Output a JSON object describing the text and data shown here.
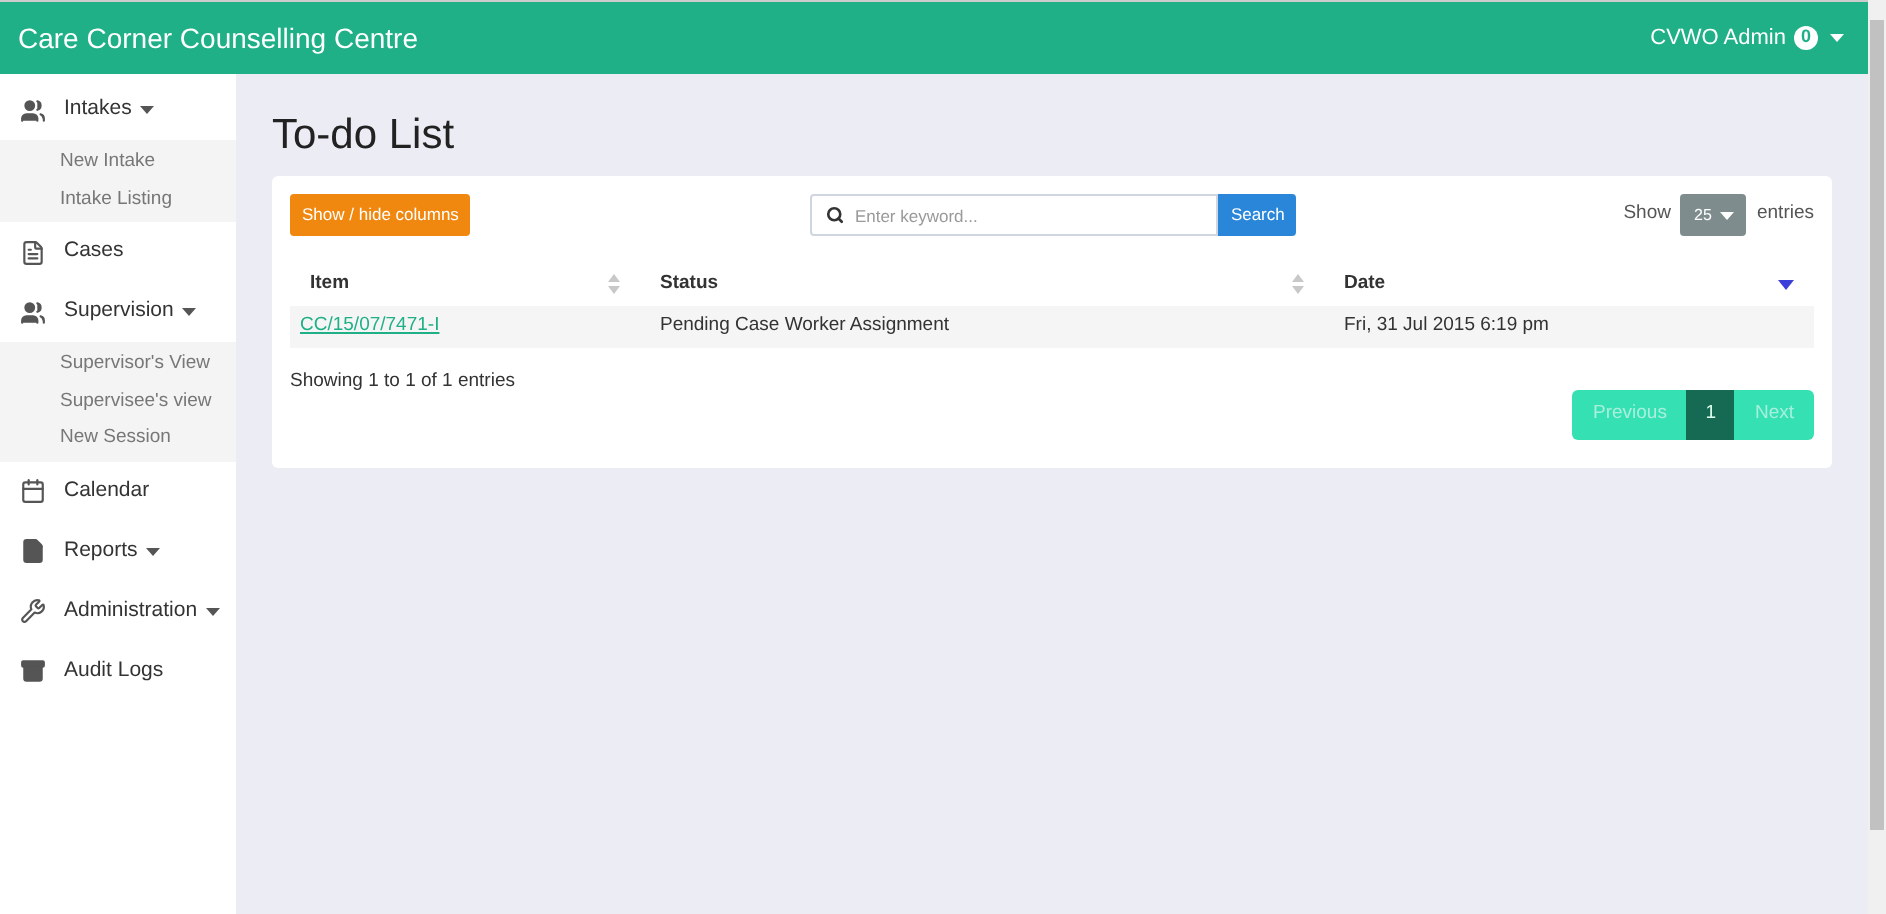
{
  "header": {
    "title": "Care Corner Counselling Centre",
    "user": "CVWO Admin",
    "badge": "0"
  },
  "sidebar": {
    "items": [
      {
        "label": "Intakes",
        "dropdown": true,
        "expanded": true,
        "children": [
          {
            "label": "New Intake"
          },
          {
            "label": "Intake Listing"
          }
        ]
      },
      {
        "label": "Cases",
        "dropdown": false,
        "expanded": false
      },
      {
        "label": "Supervision",
        "dropdown": true,
        "expanded": true,
        "children": [
          {
            "label": "Supervisor's View"
          },
          {
            "label": "Supervisee's view"
          },
          {
            "label": "New Session"
          }
        ]
      },
      {
        "label": "Calendar",
        "dropdown": false,
        "expanded": false
      },
      {
        "label": "Reports",
        "dropdown": true,
        "expanded": false
      },
      {
        "label": "Administration",
        "dropdown": true,
        "expanded": false
      },
      {
        "label": "Audit Logs",
        "dropdown": false,
        "expanded": false
      }
    ]
  },
  "page": {
    "title": "To-do List"
  },
  "toolbar": {
    "columns_button": "Show / hide columns",
    "search_placeholder": "Enter keyword...",
    "search_button": "Search",
    "show_label": "Show",
    "page_size": "25",
    "entries_label": "entries"
  },
  "table": {
    "columns": [
      {
        "label": "Item",
        "sorted": false
      },
      {
        "label": "Status",
        "sorted": false
      },
      {
        "label": "Date",
        "sorted": true
      }
    ],
    "rows": [
      {
        "item": "CC/15/07/7471-I",
        "status": "Pending Case Worker Assignment",
        "date": "Fri, 31 Jul 2015 6:19 pm"
      }
    ]
  },
  "info": "Showing 1 to 1 of 1 entries",
  "pagination": {
    "previous": {
      "label": "Previous",
      "disabled": true
    },
    "pages": [
      {
        "label": "1",
        "selected": true
      }
    ],
    "next": {
      "label": "Next",
      "disabled": true
    }
  }
}
